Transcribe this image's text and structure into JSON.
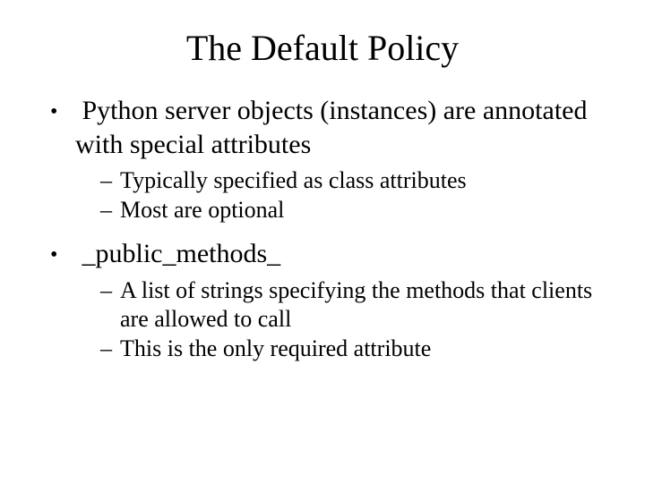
{
  "title": "The Default Policy",
  "bullets": [
    {
      "text": "Python server objects (instances) are annotated with special attributes",
      "sub": [
        "Typically specified as class attributes",
        "Most are optional"
      ]
    },
    {
      "text": "_public_methods_",
      "sub": [
        "A list of strings specifying the methods that clients are allowed to call",
        "This is the only required attribute"
      ]
    }
  ]
}
